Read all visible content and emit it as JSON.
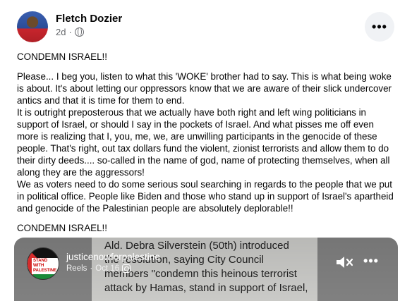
{
  "post": {
    "author": "Fletch Dozier",
    "time": "2d",
    "privacy_icon": "globe-icon",
    "more_icon": "•••",
    "paragraphs": [
      "CONDEMN ISRAEL!!",
      "Please... I beg you, listen to what this 'WOKE' brother had to say. This is what being woke is about. It's about letting our oppressors know that we are aware of their slick undercover antics and that it is time for them to end.",
      "It is outright preposterous that we actually have both right and left wing politicians in support of Israel, or should I say in the pockets of Israel. And what pisses me off even more is realizing that I, you, me, we, are unwilling participants in the genocide of these people. That's right, out tax dollars fund the violent, zionist terrorists and allow them to do their dirty deeds.... so-called in the name of god, name of protecting themselves, when all along they are the aggressors!",
      "We as voters need to do some serious soul searching in regards to the people that we put in political office. People like Biden and those who stand up in support of Israel's apartheid and genocide of the Palestinian people are absolutely deplorable!!",
      "CONDEMN ISRAEL!!"
    ]
  },
  "reel": {
    "account": "justicenowforpalestine",
    "type": "Reels",
    "date": "Oct 16",
    "avatar_text": "STAND WITH PALESTINE",
    "caption": "Ald. Debra Silverstein (50th) introduced ... resolution, saying City Council members \"condemn this heinous terrorist attack by Hamas, stand in support of Israel,",
    "caption_lines": [
      "Ald. Debra Silverstein (50th) introduced",
      "the resolution, saying City Council",
      "members \"condemn this heinous terrorist",
      "attack by Hamas, stand in support of Israel,"
    ],
    "more_icon": "•••"
  }
}
